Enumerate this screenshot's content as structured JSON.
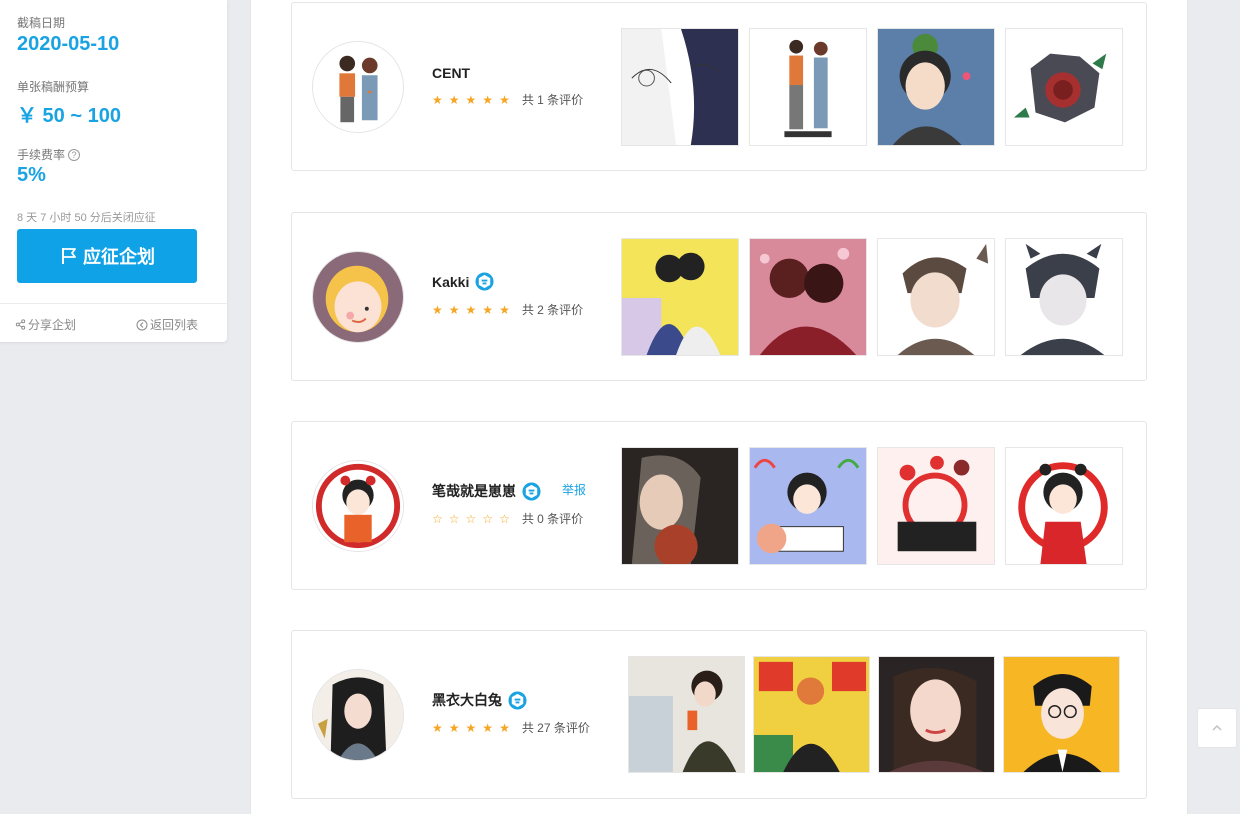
{
  "sidebar": {
    "deadline_label": "截稿日期",
    "deadline_value": "2020-05-10",
    "budget_label": "单张稿酬预算",
    "budget_value": "￥ 50 ~ 100",
    "fee_label": "手续费率",
    "fee_value": "5%",
    "countdown": "8 天 7 小时 50 分后关闭应征",
    "apply_button": "应征企划",
    "share_link": "分享企划",
    "back_link": "返回列表"
  },
  "artists": [
    {
      "name": "CENT",
      "verified": false,
      "rating": 5,
      "review_count": "共 1 条评价",
      "report": ""
    },
    {
      "name": "Kakki",
      "verified": true,
      "rating": 5,
      "review_count": "共 2 条评价",
      "report": ""
    },
    {
      "name": "笔哉就是崽崽",
      "verified": true,
      "rating": 0,
      "review_count": "共 0 条评价",
      "report": "举报"
    },
    {
      "name": "黑衣大白兔",
      "verified": true,
      "rating": 5,
      "review_count": "共 27 条评价",
      "report": ""
    }
  ],
  "icons": {
    "flag": "flag-icon",
    "share": "share-icon",
    "back": "back-circle-icon",
    "help": "help-icon",
    "badge": "verified-badge-icon",
    "scroll_top": "chevron-up-icon"
  },
  "colors": {
    "accent": "#1aa3e3",
    "button": "#0fa2e7",
    "star": "#f5a623",
    "background": "#e9ebef"
  }
}
